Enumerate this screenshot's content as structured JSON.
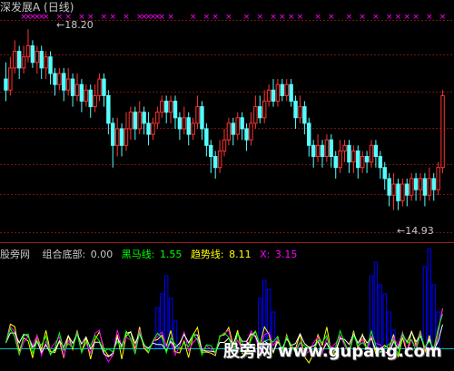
{
  "stock_title": "深发展A (日线)",
  "high_label": "18.20",
  "low_label": "14.93",
  "indicator_bar": {
    "site": "股旁网",
    "zuhe_label": "组合底部:",
    "zuhe_value": "0.00",
    "heima_label": "黑马线:",
    "heima_value": "1.55",
    "qushi_label": "趋势线:",
    "qushi_value": "8.11",
    "x_label": "X:",
    "x_value": "3.15"
  },
  "watermark": {
    "cn": "股旁网",
    "url": "www.gupang.com"
  },
  "colors": {
    "up": "#ff3232",
    "down": "#54ffff",
    "marker": "#ff00ff",
    "grid": "#7a1010",
    "heima": "#00ff00",
    "qushi": "#ffff00",
    "x": "#ff00ff",
    "hist": "#0000ff",
    "baseline": "#00c0c0",
    "white_line": "#ffffff"
  },
  "chart_data": {
    "type": "candlestick",
    "title": "深发展A (日线)",
    "price_high": 18.2,
    "price_low": 14.93,
    "ylim": [
      14.4,
      18.4
    ],
    "candles": [
      [
        17.3,
        17.1,
        17.6,
        16.9
      ],
      [
        17.1,
        17.5,
        17.7,
        17.0
      ],
      [
        17.5,
        17.8,
        18.0,
        17.4
      ],
      [
        17.8,
        17.5,
        17.9,
        17.3
      ],
      [
        17.5,
        17.7,
        17.9,
        17.4
      ],
      [
        17.7,
        17.9,
        18.2,
        17.6
      ],
      [
        17.9,
        17.6,
        18.0,
        17.5
      ],
      [
        17.6,
        17.8,
        17.9,
        17.4
      ],
      [
        17.8,
        17.5,
        17.9,
        17.3
      ],
      [
        17.5,
        17.7,
        17.8,
        17.3
      ],
      [
        17.7,
        17.4,
        17.8,
        17.2
      ],
      [
        17.4,
        17.2,
        17.5,
        17.0
      ],
      [
        17.2,
        17.4,
        17.5,
        17.1
      ],
      [
        17.4,
        17.1,
        17.5,
        16.9
      ],
      [
        17.1,
        17.3,
        17.5,
        17.0
      ],
      [
        17.3,
        17.0,
        17.4,
        16.8
      ],
      [
        17.0,
        17.2,
        17.4,
        16.9
      ],
      [
        17.2,
        16.9,
        17.3,
        16.7
      ],
      [
        16.9,
        17.1,
        17.2,
        16.8
      ],
      [
        17.1,
        16.8,
        17.2,
        16.6
      ],
      [
        16.8,
        17.0,
        17.2,
        16.7
      ],
      [
        17.0,
        17.3,
        17.4,
        16.9
      ],
      [
        17.3,
        17.0,
        17.4,
        16.8
      ],
      [
        17.0,
        16.5,
        17.1,
        16.3
      ],
      [
        16.5,
        16.1,
        16.6,
        15.7
      ],
      [
        16.1,
        16.4,
        16.6,
        15.9
      ],
      [
        16.4,
        16.1,
        16.5,
        15.9
      ],
      [
        16.1,
        16.4,
        16.7,
        16.0
      ],
      [
        16.4,
        16.7,
        16.8,
        16.2
      ],
      [
        16.7,
        16.4,
        16.8,
        16.2
      ],
      [
        16.4,
        16.7,
        16.9,
        16.3
      ],
      [
        16.7,
        16.5,
        16.8,
        16.3
      ],
      [
        16.5,
        16.3,
        16.7,
        16.1
      ],
      [
        16.3,
        16.5,
        16.6,
        16.2
      ],
      [
        16.5,
        16.7,
        16.8,
        16.4
      ],
      [
        16.7,
        16.9,
        17.0,
        16.6
      ],
      [
        16.9,
        16.7,
        17.0,
        16.5
      ],
      [
        16.7,
        16.9,
        17.0,
        16.5
      ],
      [
        16.9,
        16.6,
        17.0,
        16.4
      ],
      [
        16.6,
        16.4,
        16.7,
        16.2
      ],
      [
        16.4,
        16.6,
        16.8,
        16.3
      ],
      [
        16.6,
        16.3,
        16.7,
        16.1
      ],
      [
        16.3,
        16.5,
        16.6,
        16.2
      ],
      [
        16.5,
        16.8,
        17.0,
        16.4
      ],
      [
        16.8,
        16.4,
        16.9,
        16.2
      ],
      [
        16.4,
        16.1,
        16.5,
        15.9
      ],
      [
        16.1,
        15.9,
        16.2,
        15.6
      ],
      [
        15.9,
        15.7,
        16.0,
        15.5
      ],
      [
        15.7,
        16.0,
        16.2,
        15.6
      ],
      [
        16.0,
        16.2,
        16.4,
        15.9
      ],
      [
        16.2,
        16.5,
        16.6,
        16.1
      ],
      [
        16.5,
        16.3,
        16.6,
        16.1
      ],
      [
        16.3,
        16.6,
        16.7,
        16.2
      ],
      [
        16.6,
        16.4,
        16.7,
        16.2
      ],
      [
        16.4,
        16.2,
        16.5,
        16.0
      ],
      [
        16.2,
        16.5,
        16.7,
        16.1
      ],
      [
        16.5,
        16.8,
        17.0,
        16.4
      ],
      [
        16.8,
        16.6,
        17.0,
        16.5
      ],
      [
        16.6,
        16.9,
        17.1,
        16.5
      ],
      [
        16.9,
        17.1,
        17.2,
        16.8
      ],
      [
        17.1,
        16.9,
        17.3,
        16.8
      ],
      [
        16.9,
        17.2,
        17.3,
        16.8
      ],
      [
        17.2,
        17.0,
        17.3,
        16.9
      ],
      [
        17.0,
        17.2,
        17.3,
        16.9
      ],
      [
        17.2,
        16.9,
        17.3,
        16.8
      ],
      [
        16.9,
        16.6,
        17.0,
        16.4
      ],
      [
        16.6,
        16.8,
        17.0,
        16.5
      ],
      [
        16.8,
        16.5,
        16.9,
        16.3
      ],
      [
        16.5,
        16.1,
        16.6,
        15.9
      ],
      [
        16.1,
        15.9,
        16.2,
        15.7
      ],
      [
        15.9,
        16.1,
        16.3,
        15.8
      ],
      [
        16.1,
        15.9,
        16.2,
        15.7
      ],
      [
        15.9,
        16.2,
        16.3,
        15.8
      ],
      [
        16.2,
        15.9,
        16.3,
        15.7
      ],
      [
        15.9,
        15.7,
        16.0,
        15.5
      ],
      [
        15.7,
        16.0,
        16.2,
        15.6
      ],
      [
        16.0,
        16.1,
        16.2,
        15.8
      ],
      [
        16.1,
        15.8,
        16.2,
        15.6
      ],
      [
        15.8,
        16.0,
        16.1,
        15.6
      ],
      [
        16.0,
        15.7,
        16.1,
        15.5
      ],
      [
        15.7,
        15.9,
        16.0,
        15.6
      ],
      [
        15.9,
        15.8,
        16.0,
        15.6
      ],
      [
        15.8,
        16.1,
        16.2,
        15.7
      ],
      [
        16.1,
        15.9,
        16.2,
        15.7
      ],
      [
        15.9,
        15.7,
        16.0,
        15.5
      ],
      [
        15.7,
        15.5,
        15.8,
        15.3
      ],
      [
        15.5,
        15.2,
        15.6,
        15.0
      ],
      [
        15.2,
        15.4,
        15.6,
        14.93
      ],
      [
        15.4,
        15.1,
        15.5,
        14.93
      ],
      [
        15.1,
        15.4,
        15.5,
        15.0
      ],
      [
        15.4,
        15.2,
        15.5,
        15.0
      ],
      [
        15.2,
        15.5,
        15.6,
        15.1
      ],
      [
        15.5,
        15.3,
        15.6,
        15.1
      ],
      [
        15.3,
        15.5,
        15.6,
        15.1
      ],
      [
        15.5,
        15.2,
        15.6,
        15.0
      ],
      [
        15.2,
        15.5,
        15.7,
        15.1
      ],
      [
        15.5,
        15.3,
        15.6,
        15.1
      ],
      [
        15.3,
        15.7,
        15.8,
        15.2
      ],
      [
        15.7,
        17.0,
        17.1,
        15.6
      ]
    ],
    "indicator_histogram": [
      0,
      0,
      0,
      0,
      0,
      0,
      0,
      0,
      0,
      0,
      0,
      0,
      0,
      0,
      0,
      0,
      0,
      0,
      0,
      0,
      0,
      0,
      0,
      0,
      0,
      0,
      0,
      0,
      0,
      0,
      0,
      0,
      0,
      0,
      45,
      60,
      80,
      55,
      30,
      0,
      0,
      0,
      0,
      0,
      0,
      0,
      0,
      0,
      0,
      0,
      0,
      0,
      0,
      0,
      0,
      0,
      0,
      55,
      75,
      65,
      40,
      0,
      0,
      0,
      0,
      0,
      0,
      0,
      0,
      0,
      0,
      0,
      0,
      0,
      0,
      0,
      0,
      0,
      0,
      0,
      0,
      0,
      80,
      95,
      70,
      60,
      40,
      20,
      0,
      0,
      0,
      0,
      0,
      0,
      90,
      110,
      70,
      40,
      0,
      0,
      0,
      0,
      0,
      0,
      0
    ],
    "indicator_values": {
      "组合底部": 0.0,
      "黑马线": 1.55,
      "趋势线": 8.11,
      "X": 3.15
    }
  }
}
